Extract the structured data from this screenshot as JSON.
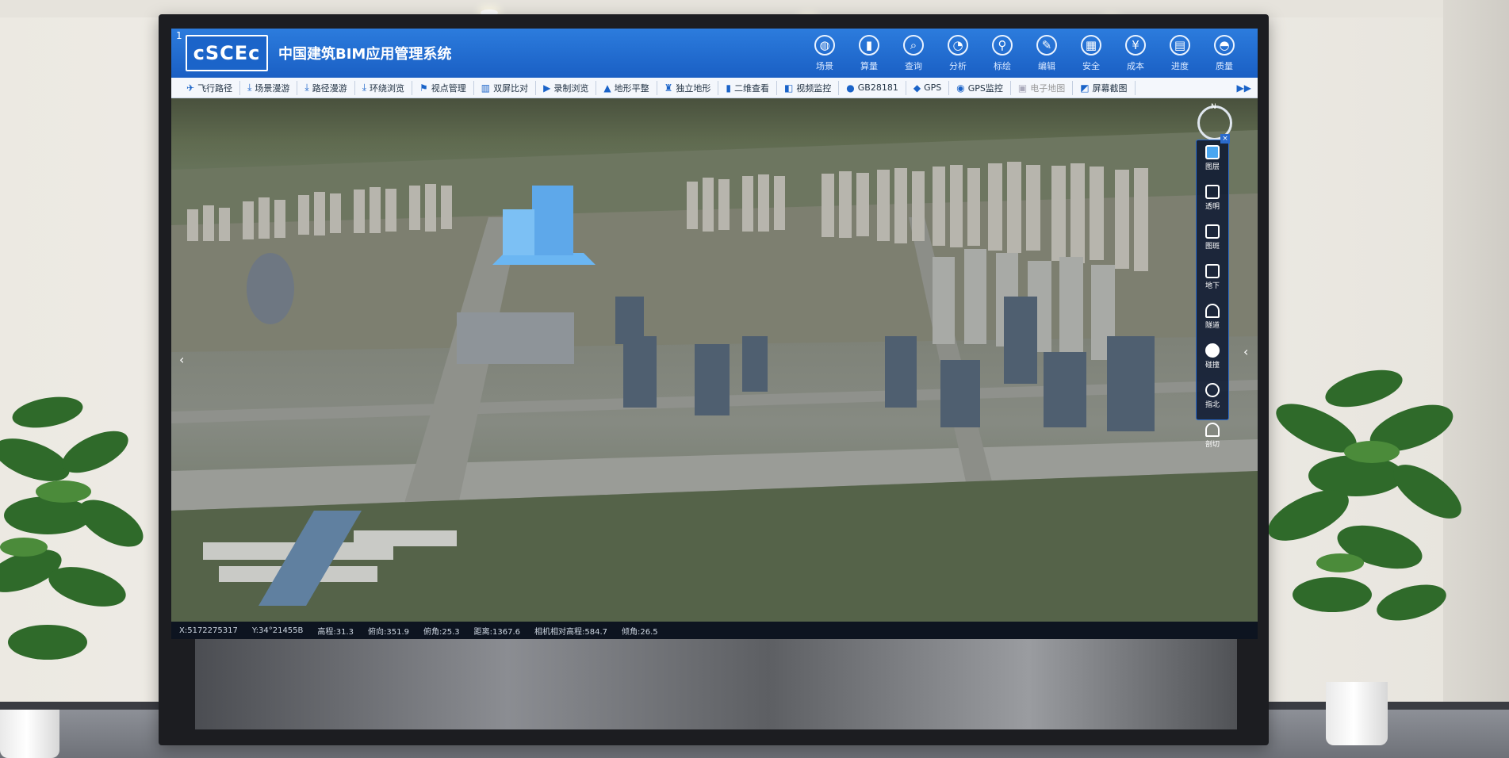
{
  "app": {
    "logo": "cSCEc",
    "logo_prefix": "1",
    "title": "中国建筑BIM应用管理系统"
  },
  "top_nav": [
    {
      "label": "场景",
      "icon": "globe-icon"
    },
    {
      "label": "算量",
      "icon": "ruler-icon"
    },
    {
      "label": "查询",
      "icon": "query-icon"
    },
    {
      "label": "分析",
      "icon": "analysis-icon"
    },
    {
      "label": "标绘",
      "icon": "pin-icon"
    },
    {
      "label": "编辑",
      "icon": "edit-icon"
    },
    {
      "label": "安全",
      "icon": "safety-icon"
    },
    {
      "label": "成本",
      "icon": "cost-icon"
    },
    {
      "label": "进度",
      "icon": "progress-icon"
    },
    {
      "label": "质量",
      "icon": "helmet-icon"
    }
  ],
  "toolbar": [
    {
      "label": "飞行路径",
      "icon": "plane-icon",
      "enabled": true
    },
    {
      "label": "场景漫游",
      "icon": "walk-icon",
      "enabled": true
    },
    {
      "label": "路径漫游",
      "icon": "route-icon",
      "enabled": true
    },
    {
      "label": "环绕浏览",
      "icon": "orbit-icon",
      "enabled": true
    },
    {
      "label": "视点管理",
      "icon": "viewpoint-icon",
      "enabled": true
    },
    {
      "label": "双屏比对",
      "icon": "split-icon",
      "enabled": true
    },
    {
      "label": "录制浏览",
      "icon": "record-icon",
      "enabled": true
    },
    {
      "label": "地形平整",
      "icon": "terrain-icon",
      "enabled": true
    },
    {
      "label": "独立地形",
      "icon": "terrain2-icon",
      "enabled": true
    },
    {
      "label": "二维查看",
      "icon": "2d-icon",
      "enabled": true
    },
    {
      "label": "视频监控",
      "icon": "video-icon",
      "enabled": true
    },
    {
      "label": "GB28181",
      "icon": "camera-icon",
      "enabled": true
    },
    {
      "label": "GPS",
      "icon": "gps-icon",
      "enabled": true
    },
    {
      "label": "GPS监控",
      "icon": "gps-monitor-icon",
      "enabled": true
    },
    {
      "label": "电子地图",
      "icon": "map-icon",
      "enabled": false
    },
    {
      "label": "屏幕截图",
      "icon": "screenshot-icon",
      "enabled": true
    }
  ],
  "side_panel": [
    {
      "label": "图层",
      "icon": "layers-icon"
    },
    {
      "label": "透明",
      "icon": "transparent-icon"
    },
    {
      "label": "图斑",
      "icon": "patch-icon"
    },
    {
      "label": "地下",
      "icon": "underground-icon"
    },
    {
      "label": "隧道",
      "icon": "tunnel-icon"
    },
    {
      "label": "碰撞",
      "icon": "collision-icon"
    },
    {
      "label": "指北",
      "icon": "north-icon"
    },
    {
      "label": "剖切",
      "icon": "clip-icon"
    }
  ],
  "status_bar": {
    "x": "X:5172275317",
    "y": "Y:34°21455B",
    "elev": "高程:31.3",
    "heading": "俯向:351.9",
    "pitch": "俯角:25.3",
    "dist": "距离:1367.6",
    "cam_height": "相机相对高程:584.7",
    "tilt": "倾角:26.5"
  },
  "compass_label": "N",
  "colors": {
    "header_blue": "#1a5fc4",
    "highlight_building": "#5ea8ea"
  }
}
